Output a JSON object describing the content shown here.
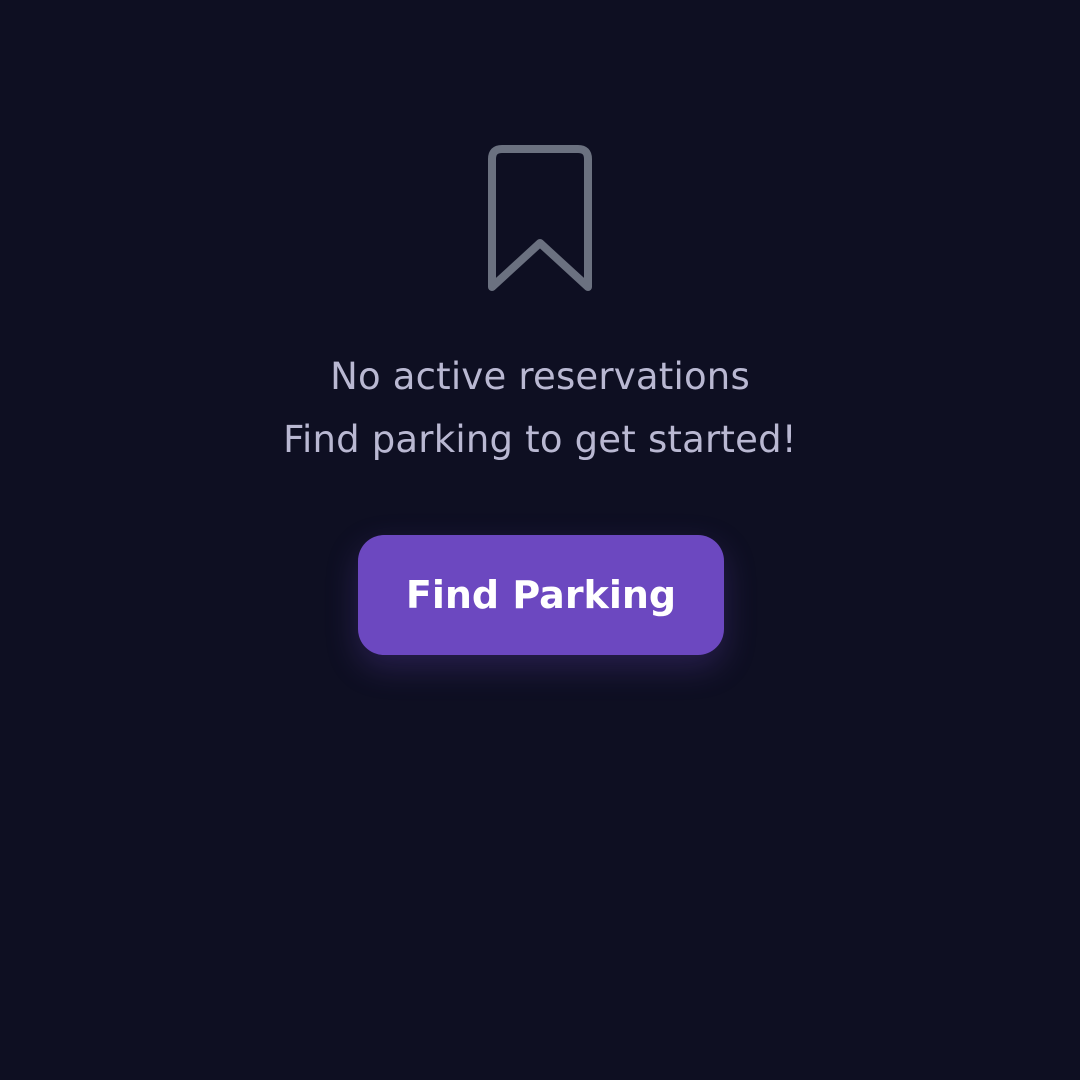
{
  "empty_state": {
    "icon": "bookmark-icon",
    "title": "No active reservations",
    "subtitle": "Find parking to get started!"
  },
  "actions": {
    "find_parking_label": "Find Parking"
  },
  "colors": {
    "background": "#0e0f22",
    "icon": "#6b7180",
    "text": "#b9b8d2",
    "accent": "#6c48c0",
    "button_text": "#ffffff"
  }
}
